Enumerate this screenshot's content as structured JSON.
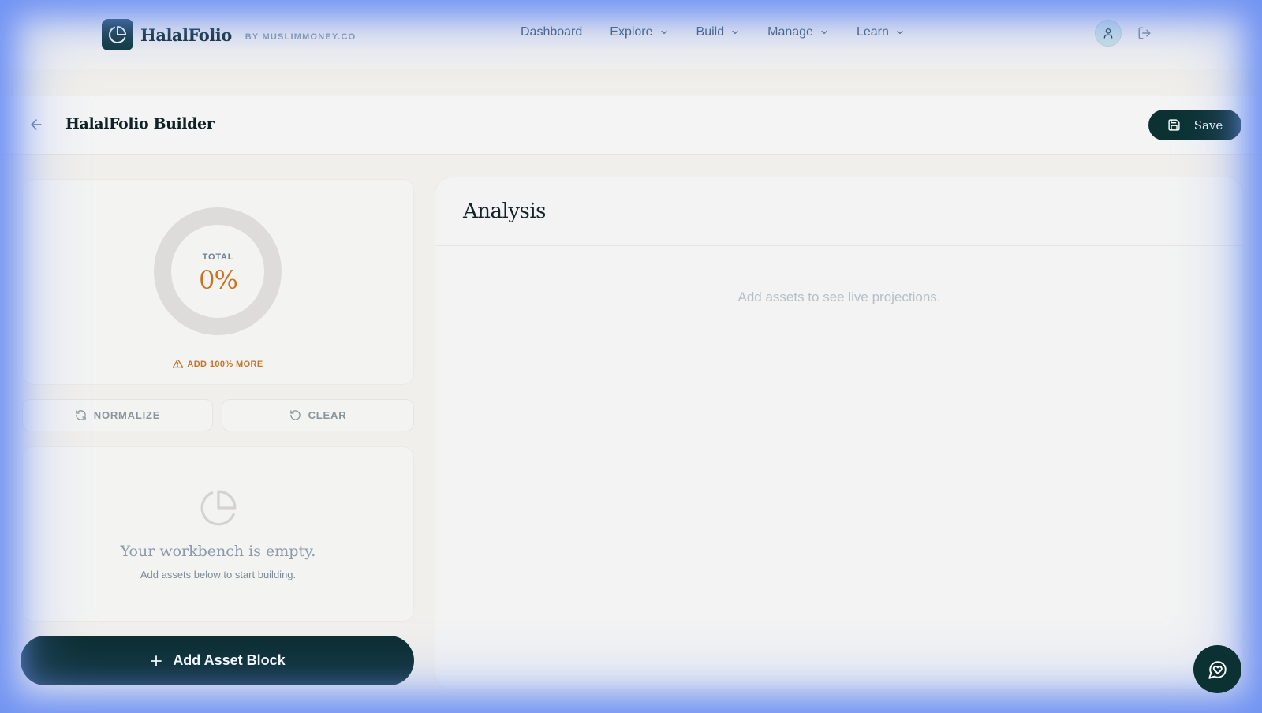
{
  "header": {
    "brand_name": "HalalFolio",
    "brand_sub": "BY MUSLIMMONEY.CO",
    "logo_icon": "pie-chart-icon",
    "nav": [
      {
        "label": "Dashboard",
        "has_menu": false
      },
      {
        "label": "Explore",
        "has_menu": true
      },
      {
        "label": "Build",
        "has_menu": true
      },
      {
        "label": "Manage",
        "has_menu": true
      },
      {
        "label": "Learn",
        "has_menu": true
      }
    ]
  },
  "builder": {
    "title": "HalalFolio Builder",
    "save_label": "Save"
  },
  "allocation": {
    "total_label": "TOTAL",
    "total_value": "0%",
    "total_fraction": 0,
    "warning": "ADD 100% MORE",
    "normalize_label": "NORMALIZE",
    "clear_label": "CLEAR"
  },
  "workbench": {
    "empty_title": "Your workbench is empty.",
    "empty_sub": "Add assets below to start building.",
    "add_label": "Add Asset Block"
  },
  "analysis": {
    "title": "Analysis",
    "empty_text": "Add assets to see live projections."
  },
  "colors": {
    "brand_dark": "#0b3132",
    "accent_orange": "#c97322",
    "glow_blue": "#6f92f3"
  }
}
